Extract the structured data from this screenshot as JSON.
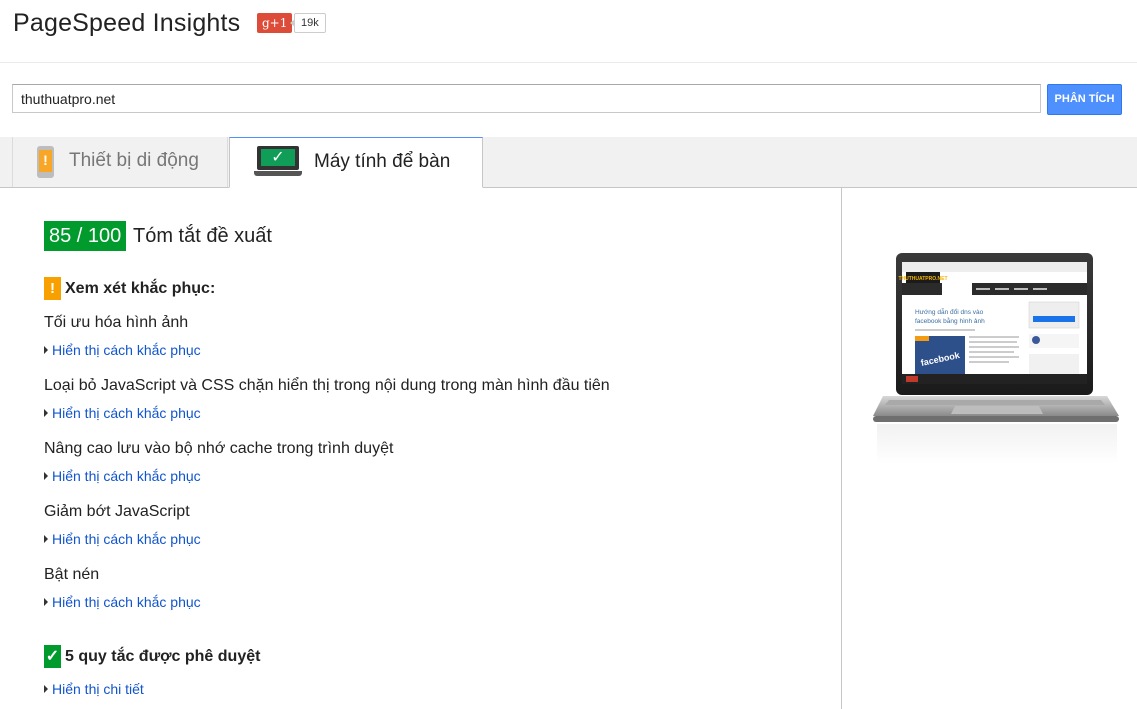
{
  "header": {
    "title": "PageSpeed Insights",
    "gplus_label": "g+1",
    "gplus_count": "19k"
  },
  "search": {
    "url_value": "thuthuatpro.net",
    "analyze_label": "PHÂN TÍCH"
  },
  "tabs": [
    {
      "label": "Thiết bị di động",
      "icon": "mobile-warning-icon",
      "active": false
    },
    {
      "label": "Máy tính để bàn",
      "icon": "desktop-check-icon",
      "active": true
    }
  ],
  "summary": {
    "score": "85 / 100",
    "title": "Tóm tắt đề xuất"
  },
  "consider": {
    "icon_glyph": "!",
    "title": "Xem xét khắc phục:",
    "rules": [
      {
        "name": "Tối ưu hóa hình ảnh",
        "link": "Hiển thị cách khắc phục"
      },
      {
        "name": "Loại bỏ JavaScript và CSS chặn hiển thị trong nội dung trong màn hình đầu tiên",
        "link": "Hiển thị cách khắc phục"
      },
      {
        "name": "Nâng cao lưu vào bộ nhớ cache trong trình duyệt",
        "link": "Hiển thị cách khắc phục"
      },
      {
        "name": "Giảm bớt JavaScript",
        "link": "Hiển thị cách khắc phục"
      },
      {
        "name": "Bật nén",
        "link": "Hiển thị cách khắc phục"
      }
    ]
  },
  "passed": {
    "icon_glyph": "✓",
    "title": "5 quy tắc được phê duyệt",
    "link": "Hiển thị chi tiết"
  },
  "preview": {
    "site_logo_text": "THUTHUATPRO.NET",
    "post_title": "Hướng dẫn đổi dns vào facebook bằng hình ảnh",
    "image_text": "facebook"
  },
  "colors": {
    "score_green": "#009a2d",
    "warning_orange": "#f8a000",
    "link_blue": "#1155cc",
    "button_blue": "#4d90fe"
  }
}
